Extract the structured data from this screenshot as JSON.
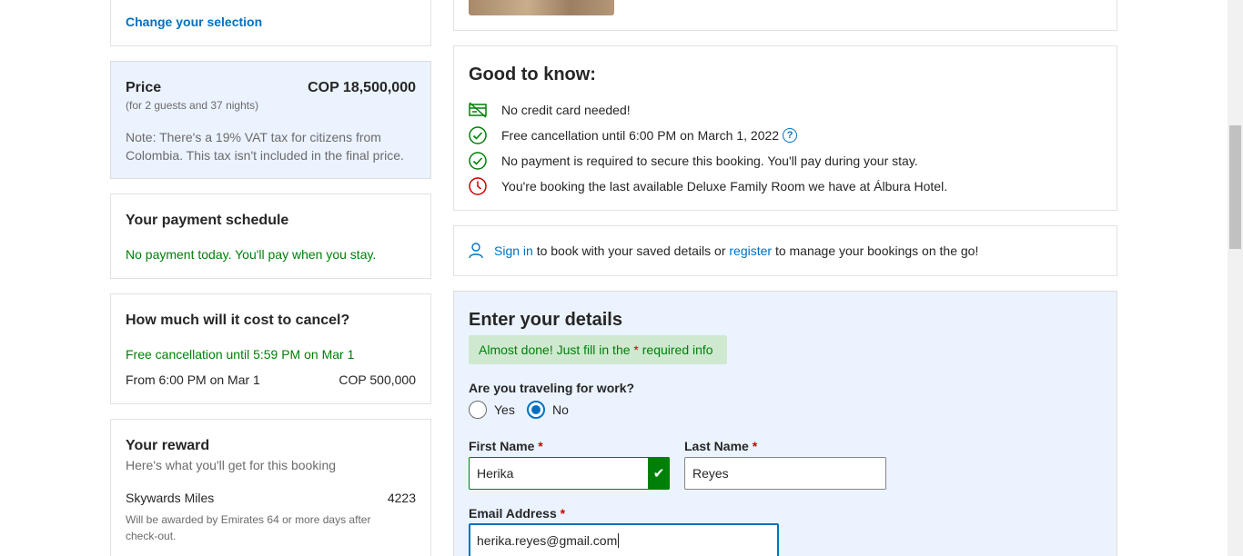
{
  "selection": {
    "change_link": "Change your selection"
  },
  "price": {
    "label": "Price",
    "amount": "COP 18,500,000",
    "subtitle": "(for 2 guests and 37 nights)",
    "note_line1": "Note: There's a 19% VAT tax for citizens from",
    "note_line2": "Colombia. This tax isn't included in the final price."
  },
  "payment_schedule": {
    "title": "Your payment schedule",
    "text": "No payment today. You'll pay when you stay."
  },
  "cancel_cost": {
    "title": "How much will it cost to cancel?",
    "free_text": "Free cancellation until 5:59 PM on Mar 1",
    "from_text": "From 6:00 PM on Mar 1",
    "from_amount": "COP 500,000"
  },
  "reward": {
    "title": "Your reward",
    "subtitle": "Here's what you'll get for this booking",
    "miles_label": "Skywards Miles",
    "miles_value": "4223",
    "note_line1": "Will be awarded by Emirates 64 or more days after",
    "note_line2": "check-out."
  },
  "good_to_know": {
    "title": "Good to know:",
    "items": [
      {
        "icon": "no-card-icon",
        "text": "No credit card needed!"
      },
      {
        "icon": "check-circle-icon",
        "text": "Free cancellation until 6:00 PM on March 1, 2022"
      },
      {
        "icon": "check-circle-icon",
        "text": "No payment is required to secure this booking. You'll pay during your stay."
      },
      {
        "icon": "clock-icon",
        "text": "You're booking the last available Deluxe Family Room we have at Álbura Hotel."
      }
    ],
    "help_glyph": "?"
  },
  "signin": {
    "sign_in": "Sign in",
    "middle": " to book with your saved details or ",
    "register": "register",
    "end": " to manage your bookings on the go!"
  },
  "details": {
    "title": "Enter your details",
    "banner_prefix": "Almost done! Just fill in the ",
    "banner_star": "*",
    "banner_suffix": " required info",
    "work_question": "Are you traveling for work?",
    "yes_label": "Yes",
    "no_label": "No",
    "first_name_label": "First Name",
    "first_name_value": "Herika",
    "last_name_label": "Last Name",
    "last_name_value": "Reyes",
    "email_label": "Email Address",
    "email_value": "herika.reyes@gmail.com",
    "required_star": "*"
  },
  "colors": {
    "accent": "#0071c2",
    "success": "#008009",
    "danger": "#cc0000",
    "info_bg": "#ebf3ff",
    "banner_bg": "#cfe9d0"
  }
}
